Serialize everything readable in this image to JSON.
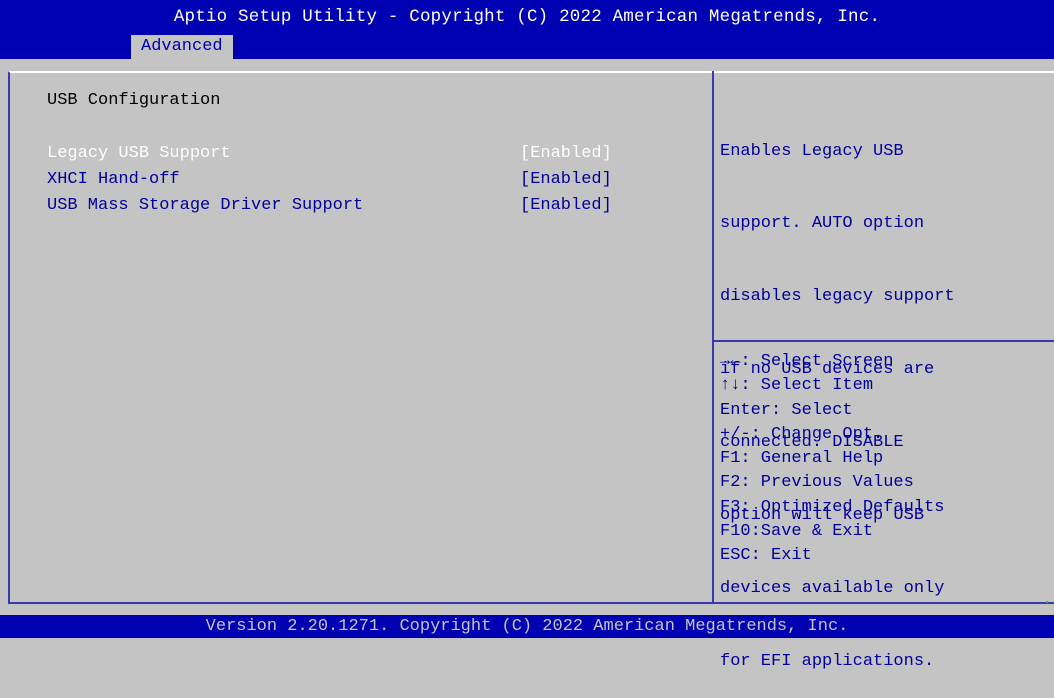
{
  "header": {
    "title": "Aptio Setup Utility - Copyright (C) 2022 American Megatrends, Inc.",
    "active_tab": "Advanced"
  },
  "main": {
    "section_title": "USB Configuration",
    "settings": [
      {
        "label": "Legacy USB Support",
        "value": "[Enabled]"
      },
      {
        "label": "XHCI Hand-off",
        "value": "[Enabled]"
      },
      {
        "label": "USB Mass Storage Driver Support",
        "value": "[Enabled]"
      }
    ]
  },
  "help": {
    "lines": [
      "Enables Legacy USB",
      "support. AUTO option",
      "disables legacy support",
      "if no USB devices are",
      "connected. DISABLE",
      "option will keep USB",
      "devices available only",
      "for EFI applications."
    ]
  },
  "keys": [
    "→←: Select Screen",
    "↑↓: Select Item",
    "Enter: Select",
    "+/-: Change Opt.",
    "F1: General Help",
    "F2: Previous Values",
    "F3: Optimized Defaults",
    "F10:Save & Exit",
    "ESC: Exit"
  ],
  "footer": {
    "text": "Version 2.20.1271. Copyright (C) 2022 American Megatrends, Inc."
  },
  "colors": {
    "header_blue": "#0000b3",
    "panel_gray": "#c4c4c4",
    "text_blue": "#00009a",
    "selected_white": "#ffffff"
  }
}
